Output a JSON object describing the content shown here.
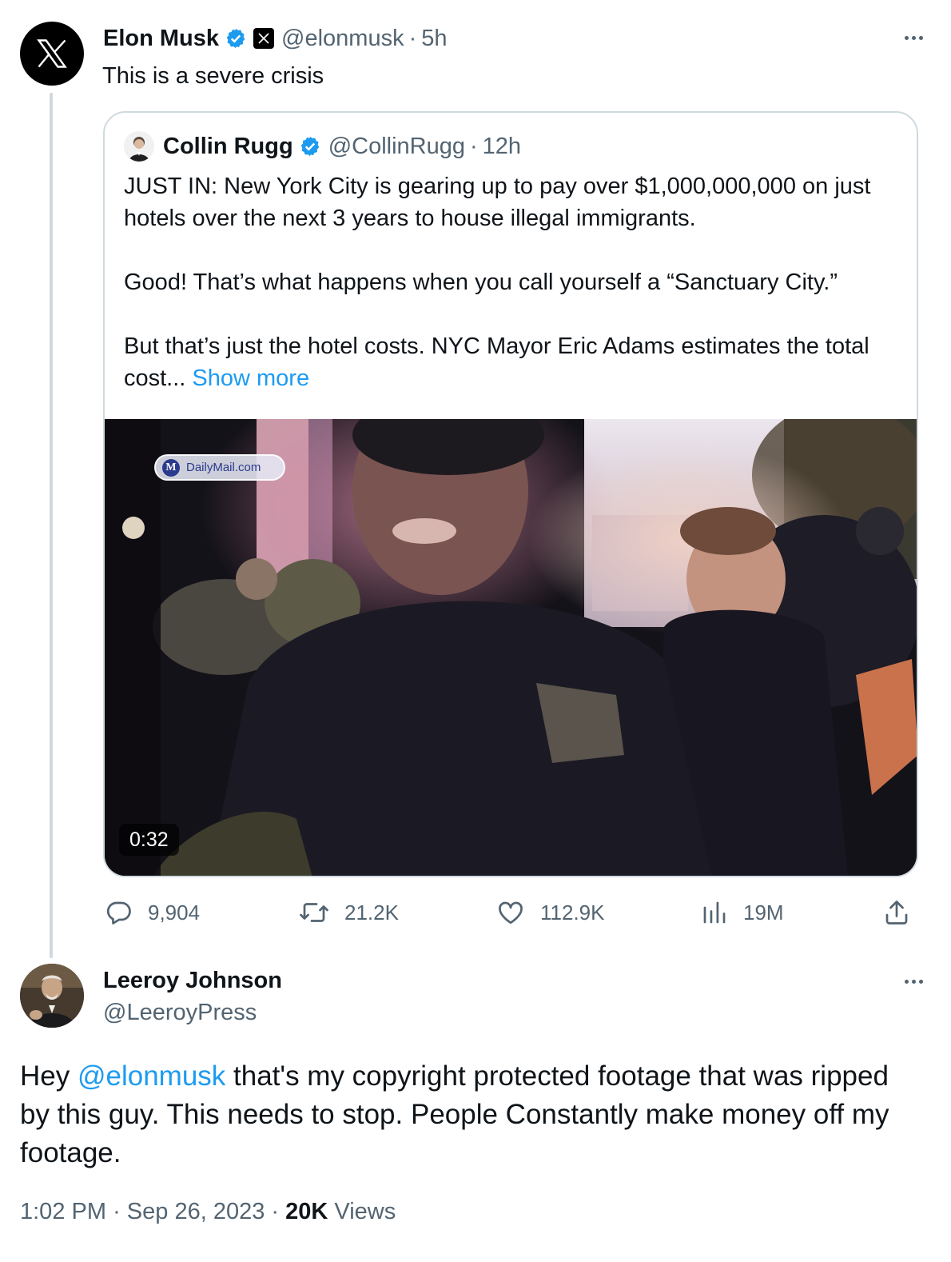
{
  "tweet": {
    "author": {
      "name": "Elon Musk",
      "handle": "@elonmusk",
      "time": "5h",
      "verified": true
    },
    "text": "This is a severe crisis",
    "quoted": {
      "author": {
        "name": "Collin Rugg",
        "handle": "@CollinRugg",
        "time": "12h",
        "verified": true
      },
      "paragraph_1": "JUST IN: New York City is gearing up to pay over $1,000,000,000 on just hotels over the next 3 years to house illegal immigrants.",
      "paragraph_2": "Good! That’s what happens when you call yourself a “Sanctuary City.”",
      "paragraph_3": "But that’s just the hotel costs. NYC Mayor Eric Adams estimates the total cost...",
      "show_more": "Show more",
      "media": {
        "watermark": "DailyMail.com",
        "watermark_mark": "M",
        "duration": "0:32"
      }
    },
    "actions": {
      "replies": "9,904",
      "reposts": "21.2K",
      "likes": "112.9K",
      "views": "19M"
    }
  },
  "reply": {
    "author": {
      "name": "Leeroy Johnson",
      "handle": "@LeeroyPress"
    },
    "text_before": "Hey ",
    "mention": "@elonmusk",
    "text_after": " that's my copyright protected footage that was ripped by this guy. This needs to stop. People Constantly make money off my footage.",
    "time": "1:02 PM",
    "date": "Sep 26, 2023",
    "views_count": "20K",
    "views_label": "Views",
    "separator": "·"
  },
  "colors": {
    "accent": "#1d9bf0",
    "text": "#0f1419",
    "muted": "#536471",
    "border": "#cfd9de"
  },
  "icons": [
    "x-logo-icon",
    "verified-badge-icon",
    "more-icon",
    "reply-icon",
    "repost-icon",
    "like-icon",
    "views-icon",
    "share-icon"
  ]
}
